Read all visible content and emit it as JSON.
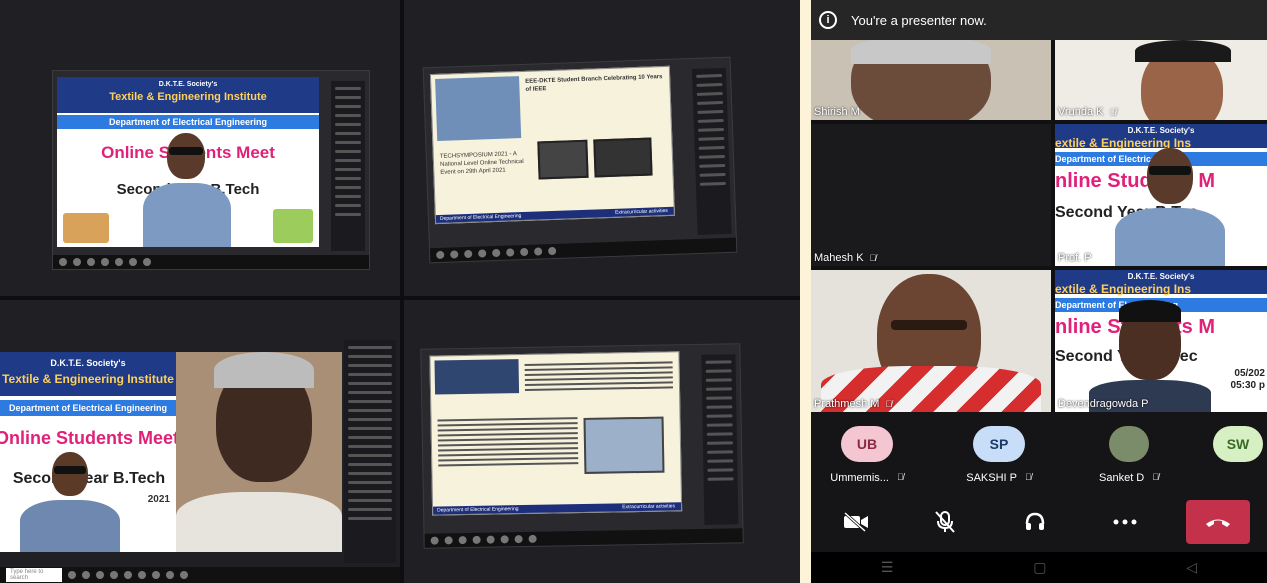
{
  "collage": {
    "q1": {
      "banner": {
        "society": "D.K.T.E. Society's",
        "institute": "Textile & Engineering Institute",
        "department": "Department of Electrical Engineering",
        "event": "Online Students Meet",
        "year": "Second Year B.Tech"
      }
    },
    "q2": {
      "slide": {
        "headline": "EEE-DKTE Student Branch Celebrating 10 Years of IEEE",
        "event_name": "TECHSYMPOSIUM 2021 - A National Level Online Technical Event on 29th April 2021",
        "footer_left": "Department of Electrical Engineering",
        "footer_right": "Extracurricular activities"
      }
    },
    "q3": {
      "banner": {
        "society": "D.K.T.E. Society's",
        "institute": "Textile & Engineering Institute",
        "department": "Department of Electrical Engineering",
        "event": "Online Students Meet",
        "year": "Second Year B.Tech",
        "year_tail": "2021"
      },
      "search_placeholder": "Type here to search"
    },
    "q4": {
      "slide": {
        "footer_left": "Department of Electrical Engineering",
        "footer_right": "Extracurricular activities"
      }
    }
  },
  "phone": {
    "presenter_notice": "You're a presenter now.",
    "tiles": [
      {
        "name": "Shirish M",
        "muted": false
      },
      {
        "name": "Vrunda K",
        "muted": true
      },
      {
        "name": "Mahesh K",
        "muted": true
      },
      {
        "name": "Prof. P",
        "muted": false
      },
      {
        "name": "Prathmesh M",
        "muted": true
      },
      {
        "name": "Devendragowda P",
        "muted": false
      }
    ],
    "banner_text": {
      "society": "D.K.T.E. Society's",
      "institute": "extile & Engineering Ins",
      "department": "Department of Electrical Eng",
      "event": "nline Students M",
      "year": "Second Year B.Tec",
      "date": "05/202",
      "time": "05:30 p"
    },
    "strip": [
      {
        "initials": "UB",
        "label": "Ummemis...",
        "color": "#f4c6d2"
      },
      {
        "initials": "SP",
        "label": "SAKSHI P",
        "color": "#c8ddf7"
      },
      {
        "initials": "",
        "label": "Sanket D",
        "color": "#7a8c6a"
      },
      {
        "initials": "SW",
        "label": "",
        "color": "#d6f0c4"
      }
    ],
    "controls": {
      "camera": "video-off-icon",
      "mic": "mic-off-icon",
      "audio": "headset-icon",
      "more": "more-icon",
      "hangup": "hang-up-icon"
    },
    "accent_colors": {
      "hangup": "#c4314b",
      "presenter_bar": "#262626"
    }
  }
}
